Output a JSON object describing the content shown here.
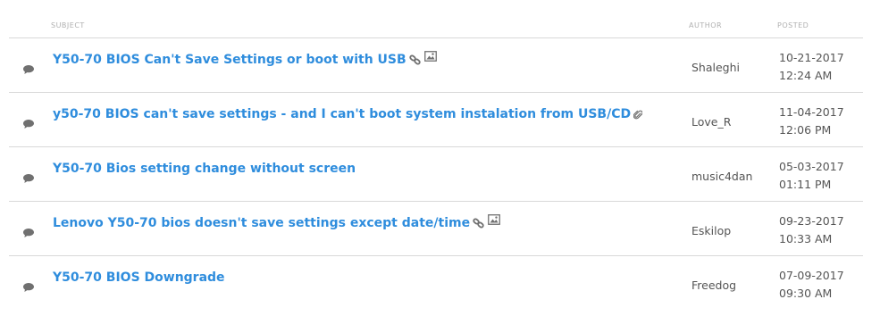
{
  "header": {
    "subject_label": "SUBJECT",
    "author_label": "AUTHOR",
    "posted_label": "POSTED"
  },
  "rows": [
    {
      "subject": "Y50-70 BIOS Can't Save Settings or boot with USB",
      "author": "Shaleghi",
      "date": "10-21-2017",
      "time": "12:24 AM",
      "icons": [
        "link-icon",
        "image-icon"
      ]
    },
    {
      "subject": "y50-70 BIOS can't save settings - and I can't boot system instalation from USB/CD",
      "author": "Love_R",
      "date": "11-04-2017",
      "time": "12:06 PM",
      "icons": [
        "paperclip-icon"
      ]
    },
    {
      "subject": "Y50-70 Bios setting change without screen",
      "author": "music4dan",
      "date": "05-03-2017",
      "time": "01:11 PM",
      "icons": []
    },
    {
      "subject": "Lenovo Y50-70 bios doesn't save settings except date/time",
      "author": "Eskilop",
      "date": "09-23-2017",
      "time": "10:33 AM",
      "icons": [
        "link-icon",
        "image-icon"
      ]
    },
    {
      "subject": "Y50-70 BIOS Downgrade",
      "author": "Freedog",
      "date": "07-09-2017",
      "time": "09:30 AM",
      "icons": []
    }
  ],
  "colors": {
    "link": "#2f8ddd",
    "text": "#555555",
    "header": "#b0b0b0",
    "divider": "#d8d8d8",
    "icon": "#707070"
  }
}
